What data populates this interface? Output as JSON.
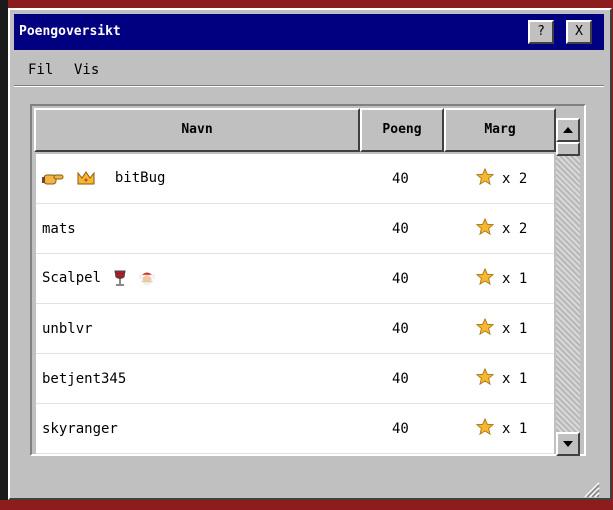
{
  "window": {
    "title": "Poengoversikt"
  },
  "titlebar": {
    "help_label": "?",
    "close_label": "X"
  },
  "menu": {
    "items": [
      {
        "label": "Fil"
      },
      {
        "label": "Vis"
      }
    ]
  },
  "table": {
    "columns": [
      "Navn",
      "Poeng",
      "Marg"
    ],
    "rows": [
      {
        "name": "bitBug",
        "score": "40",
        "marg": "x 2",
        "icons": [
          "pointing-hand-icon",
          "crown-icon"
        ]
      },
      {
        "name": "mats",
        "score": "40",
        "marg": "x 2",
        "icons": []
      },
      {
        "name": "Scalpel",
        "score": "40",
        "marg": "x 1",
        "icons": [
          "wine-glass-icon",
          "santa-face-icon"
        ]
      },
      {
        "name": "unblvr",
        "score": "40",
        "marg": "x 1",
        "icons": []
      },
      {
        "name": "betjent345",
        "score": "40",
        "marg": "x 1",
        "icons": []
      },
      {
        "name": "skyranger",
        "score": "40",
        "marg": "x 1",
        "icons": []
      }
    ]
  },
  "colors": {
    "titlebar": "#000080",
    "window": "#c0c0c0",
    "star": "#f5b82e",
    "desktop": "#8b1d1d"
  }
}
